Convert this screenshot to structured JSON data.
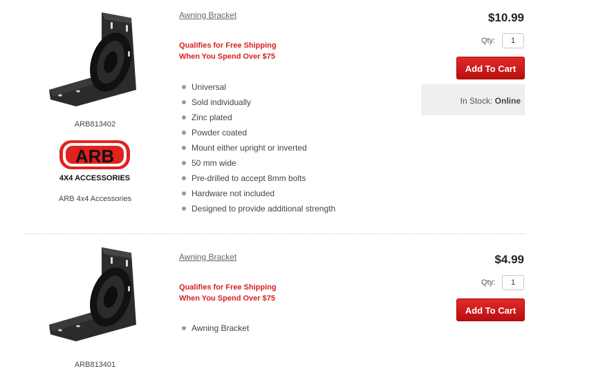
{
  "products": [
    {
      "title": "Awning Bracket",
      "sku": "ARB813402",
      "brand_logo_text": "ARB",
      "brand_logo_sub": "4X4 ACCESSORIES",
      "brand_name": "ARB 4x4 Accessories",
      "shipping_line1": "Qualifies for Free Shipping",
      "shipping_line2": "When You Spend Over $75",
      "features": [
        "Universal",
        "Sold individually",
        "Zinc plated",
        "Powder coated",
        "Mount either upright or inverted",
        "50 mm wide",
        "Pre-drilled to accept 8mm bolts",
        "Hardware not included",
        "Designed to provide additional strength"
      ],
      "price": "$10.99",
      "qty_label": "Qty:",
      "qty_value": "1",
      "add_to_cart": "Add To Cart",
      "stock_label": "In Stock:",
      "stock_value": "Online"
    },
    {
      "title": "Awning Bracket",
      "sku": "ARB813401",
      "shipping_line1": "Qualifies for Free Shipping",
      "shipping_line2": "When You Spend Over $75",
      "features": [
        "Awning Bracket"
      ],
      "price": "$4.99",
      "qty_label": "Qty:",
      "qty_value": "1",
      "add_to_cart": "Add To Cart"
    }
  ],
  "colors": {
    "accent_red": "#d62020",
    "button_red": "#c91515",
    "stock_bg": "#efefef"
  }
}
